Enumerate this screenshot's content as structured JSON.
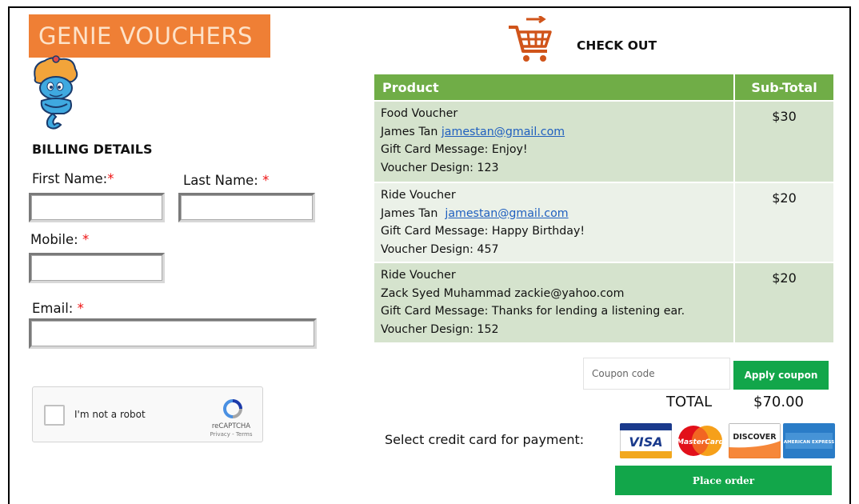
{
  "brand": {
    "name": "GENIE VOUCHERS"
  },
  "billing": {
    "title": "BILLING DETAILS",
    "first_name_label": "First Name:",
    "last_name_label": "Last Name:",
    "mobile_label": "Mobile:",
    "email_label": "Email:",
    "required_mark": "*",
    "first_name_value": "",
    "last_name_value": "",
    "mobile_value": "",
    "email_value": ""
  },
  "captcha": {
    "label": "I'm not a robot",
    "brand": "reCAPTCHA",
    "links": "Privacy - Terms"
  },
  "checkout": {
    "title": "CHECK OUT",
    "columns": [
      "Product",
      "Sub-Total"
    ],
    "items": [
      {
        "product": "Food Voucher",
        "recipient": "James Tan",
        "email": "jamestan@gmail.com",
        "message": "Gift Card Message: Enjoy!",
        "design": "Voucher Design: 123",
        "subtotal": "$30"
      },
      {
        "product": "Ride Voucher",
        "recipient": "James Tan",
        "email": "jamestan@gmail.com",
        "message": "Gift Card Message: Happy Birthday!",
        "design": "Voucher Design: 457",
        "subtotal": "$20"
      },
      {
        "product": "Ride Voucher",
        "recipient": "Zack Syed Muhammad",
        "email": "zackie@yahoo.com",
        "message": "Gift Card Message: Thanks for lending a listening ear.",
        "design": "Voucher Design: 152",
        "subtotal": "$20"
      }
    ]
  },
  "coupon": {
    "placeholder": "Coupon code",
    "button_label": "Apply coupon"
  },
  "total": {
    "label": "TOTAL",
    "value": "$70.00"
  },
  "payment": {
    "label": "Select credit card for payment:",
    "cards": [
      {
        "name": "VISA",
        "icon": "visa-card-icon"
      },
      {
        "name": "MasterCard",
        "icon": "mastercard-icon"
      },
      {
        "name": "DISCOVER",
        "icon": "discover-card-icon"
      },
      {
        "name": "AMERICAN EXPRESS",
        "icon": "amex-card-icon"
      }
    ],
    "place_order_label": "Place order"
  },
  "colors": {
    "brand_orange": "#ef7f35",
    "table_header": "#70ad47",
    "row_dark": "#d5e3cd",
    "row_light": "#ebf1e8",
    "button_green": "#12a64a",
    "required_red": "#ee1111"
  }
}
